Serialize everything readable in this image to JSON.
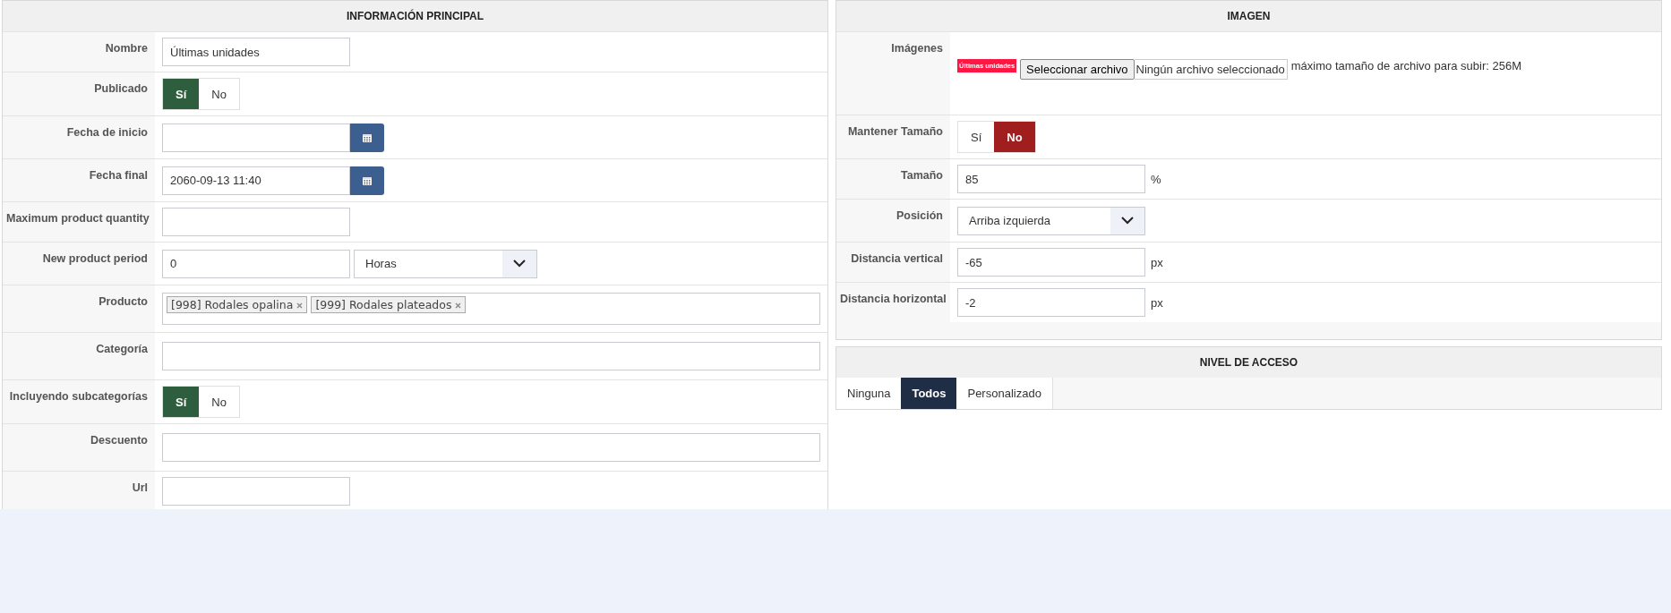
{
  "main": {
    "title": "INFORMACIÓN PRINCIPAL",
    "rows": [
      {
        "kind": "text",
        "label": "Nombre",
        "value": "Últimas unidades"
      },
      {
        "kind": "toggle",
        "label": "Publicado",
        "options": [
          {
            "label": "Sí",
            "kind": "yes",
            "selected": true
          },
          {
            "label": "No",
            "kind": "no",
            "selected": false
          }
        ]
      },
      {
        "kind": "date",
        "label": "Fecha de inicio",
        "value": ""
      },
      {
        "kind": "date",
        "label": "Fecha final",
        "value": "2060-09-13 11:40"
      },
      {
        "kind": "text",
        "label": "Maximum product quantity",
        "value": ""
      },
      {
        "kind": "period",
        "label": "New product period",
        "value": "0",
        "unit": "Horas"
      },
      {
        "kind": "tags",
        "label": "Producto",
        "tags": [
          "[998] Rodales opalina",
          "[999] Rodales plateados"
        ]
      },
      {
        "kind": "wide",
        "label": "Categoría",
        "value": ""
      },
      {
        "kind": "toggle",
        "label": "Incluyendo subcategorías",
        "options": [
          {
            "label": "Sí",
            "kind": "yes",
            "selected": true
          },
          {
            "label": "No",
            "kind": "no",
            "selected": false
          }
        ]
      },
      {
        "kind": "wide",
        "label": "Descuento",
        "value": ""
      },
      {
        "kind": "text",
        "label": "Url",
        "value": ""
      }
    ]
  },
  "image": {
    "title": "IMAGEN",
    "rows": [
      {
        "kind": "file",
        "label": "Imágenes",
        "preview": "Últimas unidades",
        "button": "Seleccionar archivo",
        "status": "Ningún archivo seleccionado",
        "note": "máximo tamaño de archivo para subir: 256M"
      },
      {
        "kind": "toggle",
        "label": "Mantener Tamaño",
        "options": [
          {
            "label": "Sí",
            "kind": "yes",
            "selected": false
          },
          {
            "label": "No",
            "kind": "no",
            "selected": true
          }
        ]
      },
      {
        "kind": "unit",
        "label": "Tamaño",
        "value": "85",
        "unit": "%"
      },
      {
        "kind": "select",
        "label": "Posición",
        "value": "Arriba izquierda"
      },
      {
        "kind": "unit",
        "label": "Distancia vertical",
        "value": "-65",
        "unit": "px"
      },
      {
        "kind": "unit",
        "label": "Distancia horizontal",
        "value": "-2",
        "unit": "px"
      }
    ]
  },
  "access": {
    "title": "NIVEL DE ACCESO",
    "tabs": [
      {
        "label": "Ninguna",
        "selected": false
      },
      {
        "label": "Todos",
        "selected": true
      },
      {
        "label": "Personalizado",
        "selected": false
      }
    ]
  }
}
